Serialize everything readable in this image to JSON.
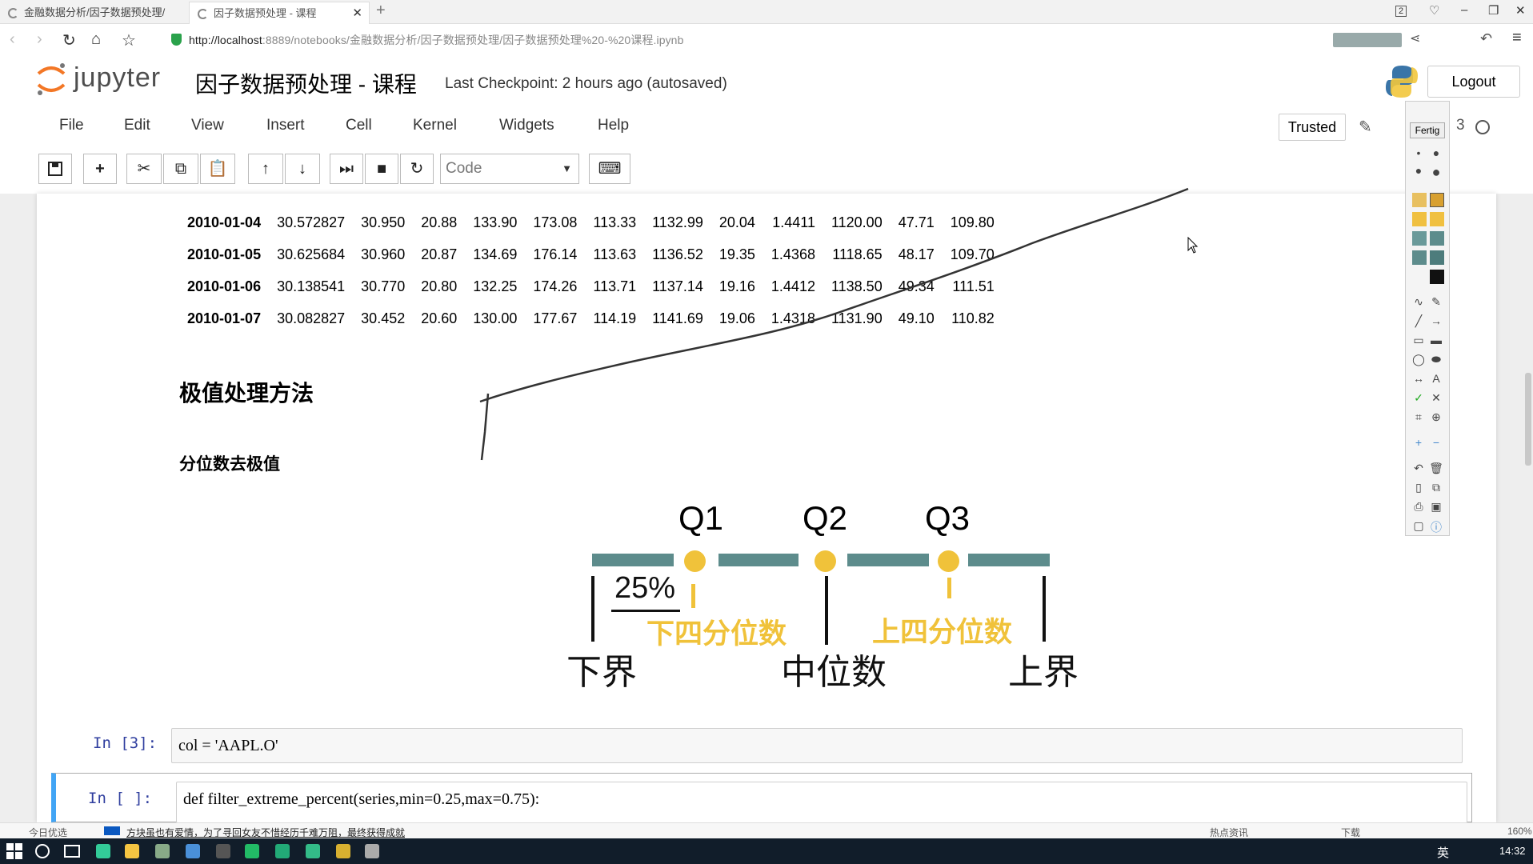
{
  "browser": {
    "tabs": [
      {
        "title": "金融数据分析/因子数据预处理/"
      },
      {
        "title": "因子数据预处理 - 课程"
      }
    ],
    "url_host": "http://localhost",
    "url_rest": ":8889/notebooks/金融数据分析/因子数据预处理/因子数据预处理%20-%20课程.ipynb"
  },
  "jupyter": {
    "logo_text": "jupyter",
    "notebook_title": "因子数据预处理 - 课程",
    "checkpoint": "Last Checkpoint: 2 hours ago (autosaved)",
    "logout": "Logout",
    "menus": [
      "File",
      "Edit",
      "View",
      "Insert",
      "Cell",
      "Kernel",
      "Widgets",
      "Help"
    ],
    "trusted": "Trusted",
    "kernel_number": "3",
    "cell_type": "Code"
  },
  "dataframe": {
    "rows": [
      [
        "2010-01-04",
        "30.572827",
        "30.950",
        "20.88",
        "133.90",
        "173.08",
        "113.33",
        "1132.99",
        "20.04",
        "1.4411",
        "1120.00",
        "47.71",
        "109.80"
      ],
      [
        "2010-01-05",
        "30.625684",
        "30.960",
        "20.87",
        "134.69",
        "176.14",
        "113.63",
        "1136.52",
        "19.35",
        "1.4368",
        "1118.65",
        "48.17",
        "109.70"
      ],
      [
        "2010-01-06",
        "30.138541",
        "30.770",
        "20.80",
        "132.25",
        "174.26",
        "113.71",
        "1137.14",
        "19.16",
        "1.4412",
        "1138.50",
        "49.34",
        "111.51"
      ],
      [
        "2010-01-07",
        "30.082827",
        "30.452",
        "20.60",
        "130.00",
        "177.67",
        "114.19",
        "1141.69",
        "19.06",
        "1.4318",
        "1131.90",
        "49.10",
        "110.82"
      ]
    ]
  },
  "markdown": {
    "heading": "极值处理方法",
    "subheading": "分位数去极值"
  },
  "diagram": {
    "q1": "Q1",
    "q2": "Q2",
    "q3": "Q3",
    "percent": "25%",
    "lower_quartile": "下四分位数",
    "upper_quartile": "上四分位数",
    "lower_bound": "下界",
    "median": "中位数",
    "upper_bound": "上界",
    "colors": {
      "bar": "#5d8c8c",
      "dot": "#f0c23a"
    }
  },
  "cells": [
    {
      "prompt": "In  [3]:",
      "code": "col = 'AAPL.O'"
    },
    {
      "prompt": "In  [ ]:",
      "code": "def filter_extreme_percent(series,min=0.25,max=0.75):"
    }
  ],
  "statusbar": {
    "left": "今日优选",
    "news": "方块虽也有爱情，为了寻回女友不惜经历千难万阻，最终获得成就",
    "hot": "热点资讯",
    "download": "下载",
    "zoom": "160%"
  },
  "taskbar": {
    "time": "14:32",
    "ime": "英"
  },
  "drawbar": {
    "done_label": "Fertig"
  }
}
